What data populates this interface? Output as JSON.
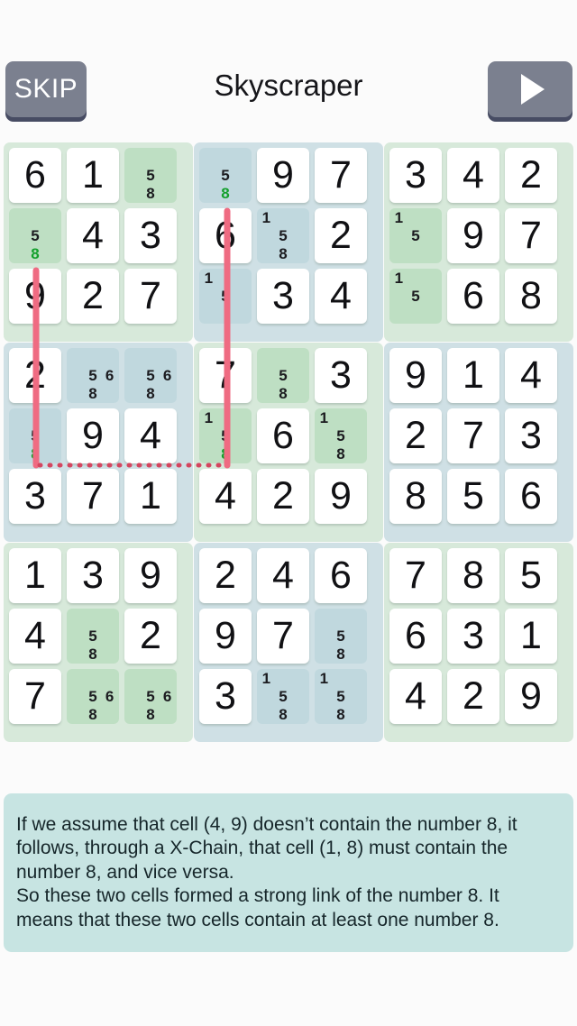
{
  "header": {
    "skip_label": "SKIP",
    "title": "Skyscraper",
    "next_icon": "play-triangle-icon"
  },
  "colors": {
    "page_background": "#fbfbfb",
    "button_face": "#7b808f",
    "button_shadow": "#474c63",
    "box_green": "#d7e9da",
    "box_blue": "#cfe0e5",
    "cell_green_highlight": "#bedfc3",
    "cell_blue_highlight": "#c0d8de",
    "cell_solved": "#ffffff",
    "chain_line": "#ef6b82",
    "chain_dotted": "#d4455f",
    "marked_candidate": "#13a02c",
    "explanation_background": "#c7e4e2",
    "digit": "#111114"
  },
  "board": {
    "boxes": [
      {
        "index": 1,
        "tint": "green"
      },
      {
        "index": 2,
        "tint": "blue"
      },
      {
        "index": 3,
        "tint": "green"
      },
      {
        "index": 4,
        "tint": "blue"
      },
      {
        "index": 5,
        "tint": "green"
      },
      {
        "index": 6,
        "tint": "blue"
      },
      {
        "index": 7,
        "tint": "green"
      },
      {
        "index": 8,
        "tint": "blue"
      },
      {
        "index": 9,
        "tint": "green"
      }
    ],
    "cells": [
      [
        {
          "value": "6"
        },
        {
          "value": "1"
        },
        {
          "candidates": [
            "5",
            "8"
          ],
          "highlight": "green"
        },
        {
          "candidates": [
            "5",
            "8"
          ],
          "highlight": "blue",
          "marked": [
            "8"
          ]
        },
        {
          "value": "9"
        },
        {
          "value": "7"
        },
        {
          "value": "3"
        },
        {
          "value": "4"
        },
        {
          "value": "2"
        }
      ],
      [
        {
          "candidates": [
            "5",
            "8"
          ],
          "highlight": "green",
          "marked": [
            "8"
          ]
        },
        {
          "value": "4"
        },
        {
          "value": "3"
        },
        {
          "value": "6"
        },
        {
          "candidates": [
            "1",
            "5",
            "8"
          ],
          "highlight": "blue"
        },
        {
          "value": "2"
        },
        {
          "candidates": [
            "1",
            "5"
          ],
          "highlight": "green"
        },
        {
          "value": "9"
        },
        {
          "value": "7"
        }
      ],
      [
        {
          "value": "9"
        },
        {
          "value": "2"
        },
        {
          "value": "7"
        },
        {
          "candidates": [
            "1",
            "5"
          ],
          "highlight": "blue"
        },
        {
          "value": "3"
        },
        {
          "value": "4"
        },
        {
          "candidates": [
            "1",
            "5"
          ],
          "highlight": "green"
        },
        {
          "value": "6"
        },
        {
          "value": "8"
        }
      ],
      [
        {
          "value": "2"
        },
        {
          "candidates": [
            "5",
            "6",
            "8"
          ],
          "highlight": "blue"
        },
        {
          "candidates": [
            "5",
            "6",
            "8"
          ],
          "highlight": "blue"
        },
        {
          "value": "7"
        },
        {
          "candidates": [
            "5",
            "8"
          ],
          "highlight": "green"
        },
        {
          "value": "3"
        },
        {
          "value": "9"
        },
        {
          "value": "1"
        },
        {
          "value": "4"
        }
      ],
      [
        {
          "candidates": [
            "5",
            "8"
          ],
          "highlight": "blue",
          "marked": [
            "8"
          ]
        },
        {
          "value": "9"
        },
        {
          "value": "4"
        },
        {
          "candidates": [
            "1",
            "5",
            "8"
          ],
          "highlight": "green",
          "marked": [
            "8"
          ]
        },
        {
          "value": "6"
        },
        {
          "candidates": [
            "1",
            "5",
            "8"
          ],
          "highlight": "green"
        },
        {
          "value": "2"
        },
        {
          "value": "7"
        },
        {
          "value": "3"
        }
      ],
      [
        {
          "value": "3"
        },
        {
          "value": "7"
        },
        {
          "value": "1"
        },
        {
          "value": "4"
        },
        {
          "value": "2"
        },
        {
          "value": "9"
        },
        {
          "value": "8"
        },
        {
          "value": "5"
        },
        {
          "value": "6"
        }
      ],
      [
        {
          "value": "1"
        },
        {
          "value": "3"
        },
        {
          "value": "9"
        },
        {
          "value": "2"
        },
        {
          "value": "4"
        },
        {
          "value": "6"
        },
        {
          "value": "7"
        },
        {
          "value": "8"
        },
        {
          "value": "5"
        }
      ],
      [
        {
          "value": "4"
        },
        {
          "candidates": [
            "5",
            "8"
          ],
          "highlight": "green"
        },
        {
          "value": "2"
        },
        {
          "value": "9"
        },
        {
          "value": "7"
        },
        {
          "candidates": [
            "5",
            "8"
          ],
          "highlight": "blue"
        },
        {
          "value": "6"
        },
        {
          "value": "3"
        },
        {
          "value": "1"
        }
      ],
      [
        {
          "value": "7"
        },
        {
          "candidates": [
            "5",
            "6",
            "8"
          ],
          "highlight": "green"
        },
        {
          "candidates": [
            "5",
            "6",
            "8"
          ],
          "highlight": "green"
        },
        {
          "value": "3"
        },
        {
          "candidates": [
            "1",
            "5",
            "8"
          ],
          "highlight": "blue"
        },
        {
          "candidates": [
            "1",
            "5",
            "8"
          ],
          "highlight": "blue"
        },
        {
          "value": "4"
        },
        {
          "value": "2"
        },
        {
          "value": "9"
        }
      ]
    ]
  },
  "explanation": {
    "paragraph1": "If we assume that cell (4, 9) doesn’t contain the number 8, it follows, through a X-Chain, that cell (1, 8) must contain the number 8, and vice versa.",
    "paragraph2": "So these two cells formed a strong link of the number 8. It means that these two cells contain at least one number 8."
  }
}
